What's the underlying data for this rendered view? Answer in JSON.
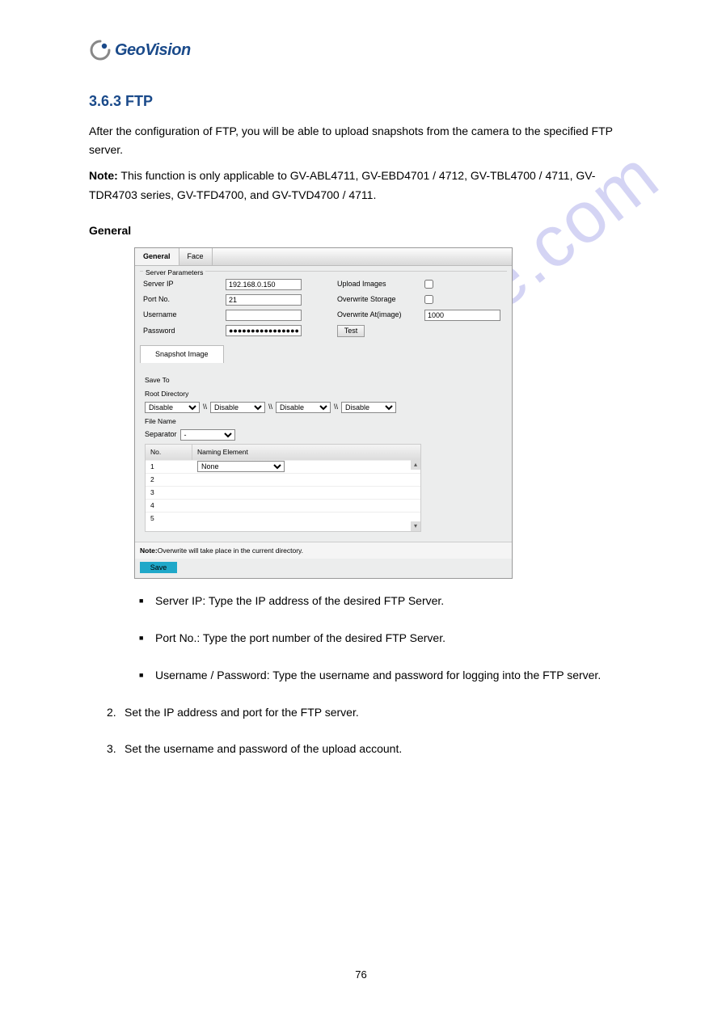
{
  "logo": {
    "brand": "GeoVision"
  },
  "heading": "3.6.3  FTP",
  "intro": "After the configuration of FTP, you will be able to upload snapshots from the camera to the specified FTP server.",
  "note": {
    "label": "Note:",
    "text": " This function is only applicable to GV-ABL4711, GV-EBD4701 / 4712, GV-TBL4700 / 4711, GV-TDR4703 series, GV-TFD4700, and GV-TVD4700 / 4711."
  },
  "subheading": "General",
  "panel": {
    "tabs": {
      "general": "General",
      "face": "Face"
    },
    "fieldset_label": "Server Parameters",
    "labels": {
      "server_ip": "Server IP",
      "port": "Port No.",
      "username": "Username",
      "password": "Password",
      "upload_images": "Upload Images",
      "overwrite_storage": "Overwrite Storage",
      "overwrite_at": "Overwrite At(image)",
      "test": "Test"
    },
    "values": {
      "server_ip": "192.168.0.150",
      "port": "21",
      "username": "",
      "password": "●●●●●●●●●●●●●●●●",
      "overwrite_at": "1000"
    },
    "snapshot_tab": "Snapshot Image",
    "save_to": "Save To",
    "root_dir": "Root Directory",
    "dir_option": "Disable",
    "file_name": "File Name",
    "separator": "Separator",
    "separator_value": "-",
    "table": {
      "head_no": "No.",
      "head_naming": "Naming Element",
      "rows": [
        "1",
        "2",
        "3",
        "4",
        "5"
      ],
      "naming_option": "None"
    },
    "note_strip_label": "Note:",
    "note_strip_text": "Overwrite will take place in the current directory.",
    "save": "Save"
  },
  "bullets": {
    "server_ip": "Server IP: Type the IP address of the desired FTP Server.",
    "port": "Port No.: Type the port number of the desired FTP Server.",
    "user_pass": "Username / Password: Type the username and password for logging into the FTP server."
  },
  "step2": {
    "num": "2.",
    "text": "Set the IP address and port for the FTP server."
  },
  "step3": {
    "num": "3.",
    "text": "Set the username and password of the upload account."
  },
  "watermark": "manualshive.com",
  "page_number": "76"
}
